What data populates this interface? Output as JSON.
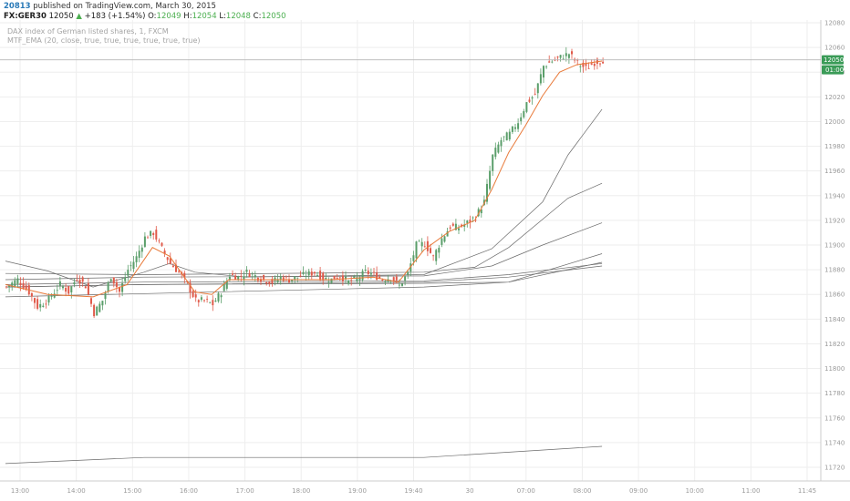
{
  "header": {
    "user": "20813",
    "published": "published on TradingView.com, March 30, 2015",
    "symbol": "FX:GER30",
    "last": "12050",
    "change_arrow": "▲",
    "change": "+183 (+1.54%)",
    "open_label": "O:",
    "open": "12049",
    "high_label": "H:",
    "high": "12054",
    "low_label": "L:",
    "low": "12048",
    "close_label": "C:",
    "close": "12050"
  },
  "overlay": {
    "title": "DAX index of German listed shares, 1, FXCM",
    "indicator": "MTF_EMA (20, close, true, true, true, true, true, true)"
  },
  "price_tag": {
    "price": "12050",
    "time": "01:00",
    "color": "#3a9b57"
  },
  "colors": {
    "up": "#5a9e6a",
    "down": "#e05a4a",
    "ema": "#e87a3a",
    "mtf": "#6a6a6a",
    "grid": "#eeeeee"
  },
  "chart_data": {
    "type": "candlestick",
    "yticks": [
      11720,
      11740,
      11760,
      11780,
      11800,
      11820,
      11840,
      11860,
      11880,
      11900,
      11920,
      11940,
      11960,
      11980,
      12000,
      12020,
      12040,
      12060,
      12080
    ],
    "ylim": [
      11720,
      12080
    ],
    "xticks": [
      "13:00",
      "14:00",
      "15:00",
      "16:00",
      "17:00",
      "18:00",
      "19:00",
      "19:40",
      "30",
      "07:00",
      "08:00",
      "09:00",
      "10:00",
      "11:00",
      "11:45"
    ],
    "last_price": 12050,
    "price_path": [
      [
        0,
        11866
      ],
      [
        4,
        11872
      ],
      [
        8,
        11862
      ],
      [
        11,
        11850
      ],
      [
        15,
        11856
      ],
      [
        19,
        11868
      ],
      [
        22,
        11862
      ],
      [
        25,
        11874
      ],
      [
        28,
        11867
      ],
      [
        31,
        11845
      ],
      [
        34,
        11855
      ],
      [
        37,
        11875
      ],
      [
        40,
        11862
      ],
      [
        43,
        11880
      ],
      [
        46,
        11890
      ],
      [
        49,
        11906
      ],
      [
        52,
        11910
      ],
      [
        55,
        11897
      ],
      [
        58,
        11885
      ],
      [
        61,
        11878
      ],
      [
        64,
        11868
      ],
      [
        67,
        11855
      ],
      [
        70,
        11855
      ],
      [
        73,
        11852
      ],
      [
        76,
        11862
      ],
      [
        79,
        11876
      ],
      [
        82,
        11874
      ],
      [
        85,
        11878
      ],
      [
        88,
        11875
      ],
      [
        91,
        11872
      ],
      [
        94,
        11870
      ],
      [
        97,
        11874
      ],
      [
        100,
        11872
      ],
      [
        103,
        11874
      ],
      [
        106,
        11876
      ],
      [
        109,
        11878
      ],
      [
        112,
        11873
      ],
      [
        115,
        11872
      ],
      [
        118,
        11875
      ],
      [
        121,
        11870
      ],
      [
        124,
        11873
      ],
      [
        127,
        11878
      ],
      [
        130,
        11876
      ],
      [
        133,
        11872
      ],
      [
        136,
        11874
      ],
      [
        139,
        11867
      ],
      [
        142,
        11877
      ],
      [
        145,
        11900
      ],
      [
        148,
        11901
      ],
      [
        151,
        11890
      ],
      [
        154,
        11905
      ],
      [
        157,
        11915
      ],
      [
        160,
        11914
      ],
      [
        163,
        11918
      ],
      [
        166,
        11923
      ],
      [
        169,
        11935
      ],
      [
        172,
        11972
      ],
      [
        175,
        11985
      ],
      [
        178,
        11990
      ],
      [
        181,
        12000
      ],
      [
        184,
        12015
      ],
      [
        187,
        12022
      ],
      [
        190,
        12045
      ],
      [
        193,
        12049
      ],
      [
        196,
        12052
      ],
      [
        199,
        12055
      ],
      [
        202,
        12047
      ],
      [
        205,
        12043
      ],
      [
        208,
        12048
      ],
      [
        211,
        12050
      ]
    ],
    "ema_series": [
      [
        0,
        11868
      ],
      [
        15,
        11860
      ],
      [
        31,
        11858
      ],
      [
        43,
        11868
      ],
      [
        52,
        11898
      ],
      [
        58,
        11891
      ],
      [
        67,
        11862
      ],
      [
        73,
        11860
      ],
      [
        79,
        11872
      ],
      [
        97,
        11872
      ],
      [
        115,
        11872
      ],
      [
        130,
        11874
      ],
      [
        139,
        11870
      ],
      [
        148,
        11896
      ],
      [
        157,
        11911
      ],
      [
        166,
        11920
      ],
      [
        172,
        11945
      ],
      [
        178,
        11975
      ],
      [
        184,
        11997
      ],
      [
        190,
        12021
      ],
      [
        196,
        12040
      ],
      [
        202,
        12046
      ],
      [
        211,
        12049
      ]
    ],
    "mtf_series": [
      {
        "points": [
          [
            0,
            11887
          ],
          [
            15,
            11879
          ],
          [
            31,
            11866
          ],
          [
            49,
            11878
          ],
          [
            58,
            11885
          ],
          [
            67,
            11878
          ],
          [
            85,
            11874
          ],
          [
            148,
            11876
          ],
          [
            172,
            11897
          ],
          [
            190,
            11935
          ],
          [
            199,
            11973
          ],
          [
            211,
            12010
          ]
        ]
      },
      {
        "points": [
          [
            0,
            11877
          ],
          [
            49,
            11876
          ],
          [
            148,
            11878
          ],
          [
            166,
            11882
          ],
          [
            178,
            11898
          ],
          [
            199,
            11938
          ],
          [
            211,
            11950
          ]
        ]
      },
      {
        "points": [
          [
            0,
            11872
          ],
          [
            49,
            11874
          ],
          [
            148,
            11875
          ],
          [
            172,
            11883
          ],
          [
            190,
            11900
          ],
          [
            211,
            11918
          ]
        ]
      },
      {
        "points": [
          [
            0,
            11866
          ],
          [
            49,
            11868
          ],
          [
            148,
            11869
          ],
          [
            178,
            11870
          ],
          [
            211,
            11893
          ]
        ]
      },
      {
        "points": [
          [
            0,
            11868
          ],
          [
            49,
            11870
          ],
          [
            148,
            11871
          ],
          [
            178,
            11876
          ],
          [
            211,
            11885
          ]
        ]
      },
      {
        "points": [
          [
            0,
            11866
          ],
          [
            49,
            11868
          ],
          [
            148,
            11870
          ],
          [
            178,
            11874
          ],
          [
            211,
            11883
          ]
        ]
      },
      {
        "points": [
          [
            0,
            11858
          ],
          [
            148,
            11866
          ],
          [
            178,
            11870
          ],
          [
            211,
            11886
          ]
        ]
      },
      {
        "points": [
          [
            0,
            11723
          ],
          [
            49,
            11728
          ],
          [
            148,
            11728
          ],
          [
            211,
            11737
          ]
        ]
      }
    ]
  }
}
